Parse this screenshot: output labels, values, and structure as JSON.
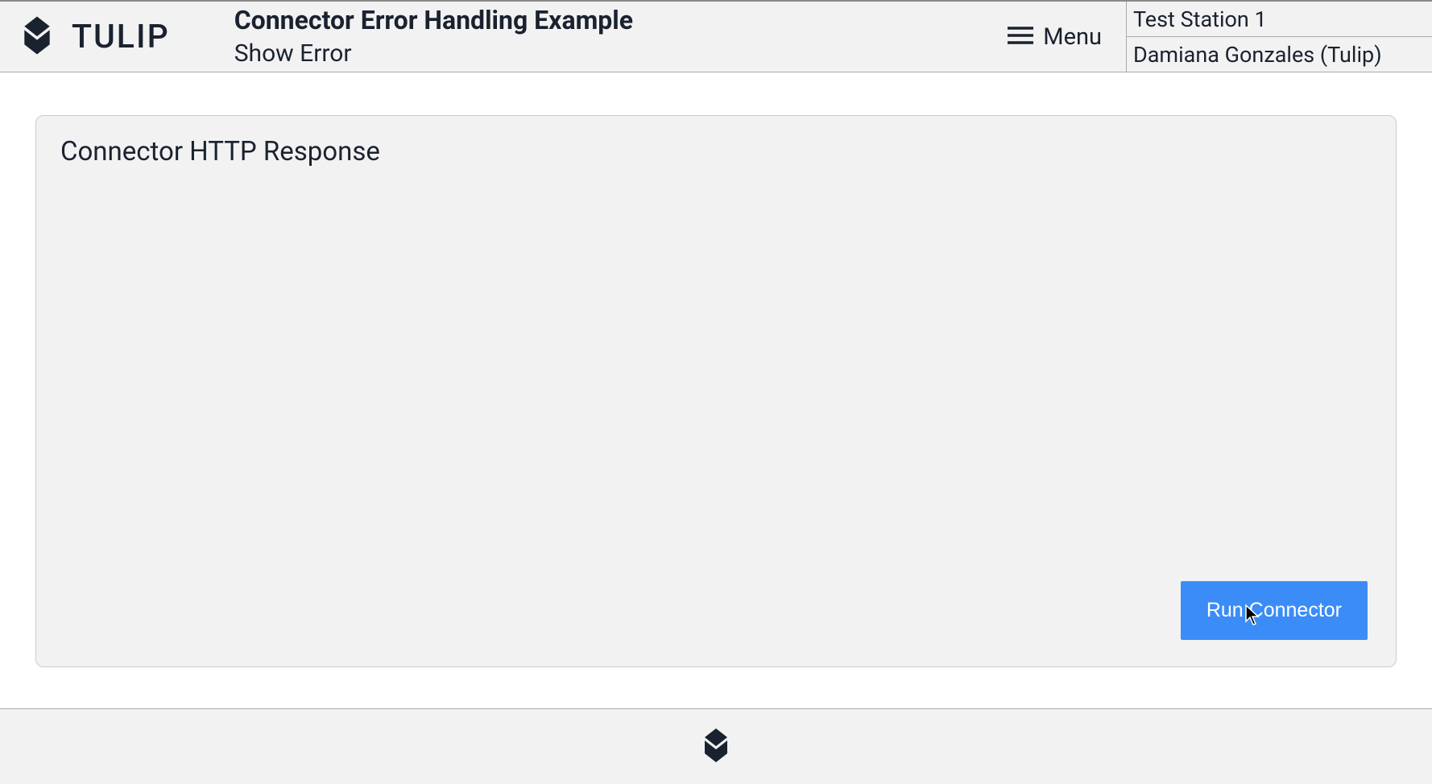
{
  "header": {
    "logo_text": "TULIP",
    "app_title": "Connector Error Handling Example",
    "app_subtitle": "Show Error",
    "menu_label": "Menu",
    "station_label": "Test Station 1",
    "user_label": "Damiana Gonzales (Tulip)"
  },
  "panel": {
    "title": "Connector HTTP Response",
    "run_button_label": "Run Connector"
  }
}
